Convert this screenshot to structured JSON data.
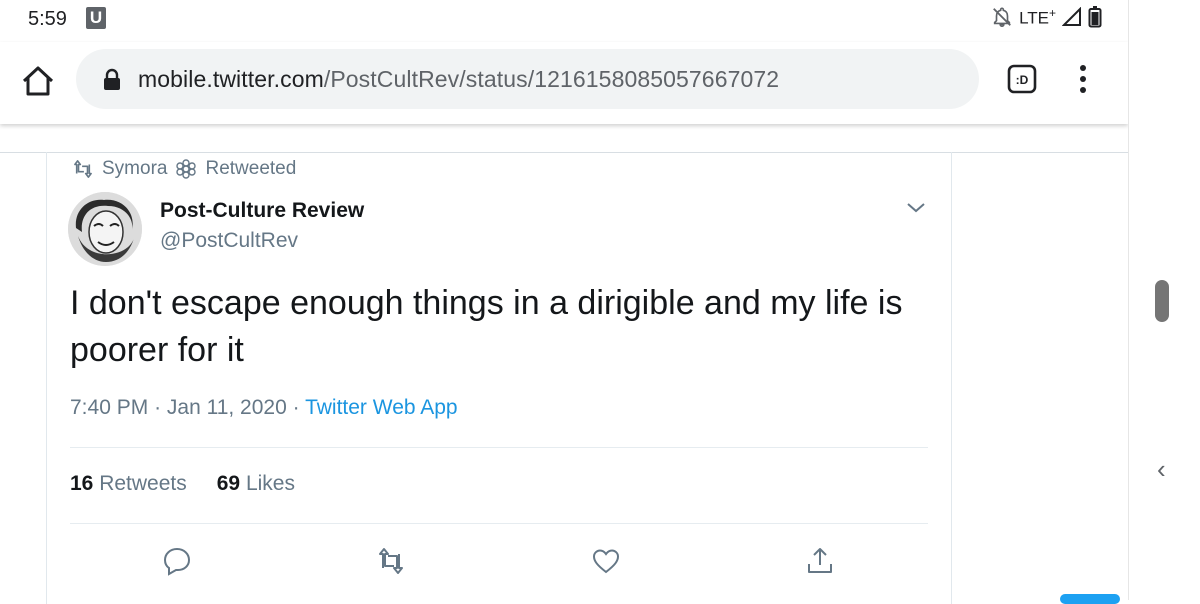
{
  "status_bar": {
    "time": "5:59",
    "notification_icon_label": "U",
    "network": "LTE",
    "network_superscript": "+",
    "icons": [
      "notifications-off-icon",
      "signal-icon",
      "battery-icon"
    ]
  },
  "browser": {
    "url_host": "mobile.twitter.com",
    "url_path": "/PostCultRev/status/1216158085057667072",
    "tab_switcher_label": ":D",
    "icons": [
      "home-icon",
      "lock-icon",
      "more-vert-icon"
    ]
  },
  "tweet": {
    "retweeted_by": "Symora",
    "retweeted_label": "Retweeted",
    "author_name": "Post-Culture Review",
    "author_handle": "@PostCultRev",
    "text": "I don't escape enough things in a dirigible and my life is poorer for it",
    "time": "7:40 PM",
    "date": "Jan 11, 2020",
    "source": "Twitter Web App",
    "retweet_count": "16",
    "retweet_label": "Retweets",
    "like_count": "69",
    "like_label": "Likes"
  },
  "colors": {
    "link_blue": "#1b95e0",
    "secondary_text": "#657786",
    "primary_text": "#14171a",
    "url_bar": "#f1f3f4"
  }
}
